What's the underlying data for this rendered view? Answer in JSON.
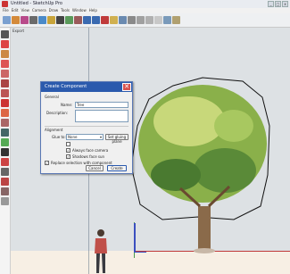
{
  "window": {
    "title": "Untitled - SketchUp Pro"
  },
  "menu": [
    "File",
    "Edit",
    "View",
    "Camera",
    "Draw",
    "Tools",
    "Window",
    "Help"
  ],
  "viewport": {
    "label": "Export"
  },
  "dialog": {
    "title": "Create Component",
    "general_label": "General",
    "name_label": "Name:",
    "name_value": "Tree",
    "description_label": "Description:",
    "alignment_label": "Alignment",
    "glue_label": "Glue to:",
    "glue_value": "None",
    "set_plane_label": "Set gluing plane",
    "always_face_label": "Always face camera",
    "shadows_face_label": "Shadows face sun",
    "replace_label": "Replace selection with component",
    "cancel_label": "Cancel",
    "create_label": "Create",
    "close_glyph": "✕"
  },
  "colors": {
    "accent": "#2b5aad",
    "tree_foliage": "#8ab04a",
    "trunk": "#8a6a4a"
  }
}
